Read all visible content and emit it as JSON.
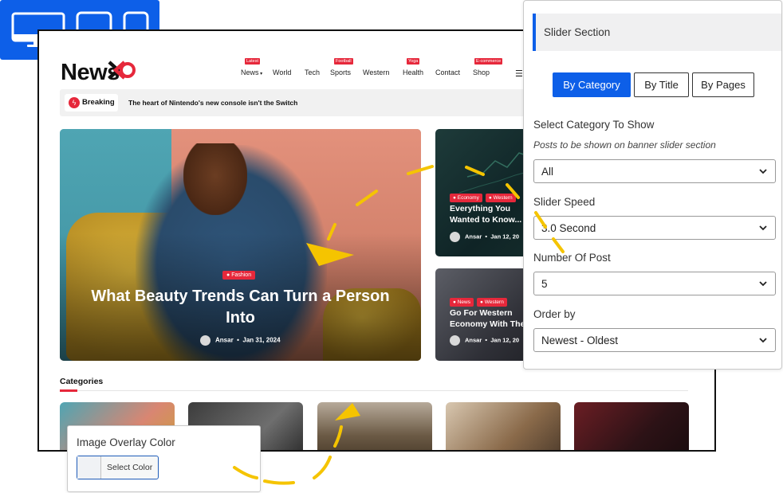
{
  "device_switcher": {
    "accent": "#0d5fe8",
    "icons": [
      "desktop-icon",
      "tablet-icon",
      "mobile-icon"
    ]
  },
  "site": {
    "logo_text": "News",
    "logo_suffix": "X",
    "nav": [
      {
        "label": "News",
        "badge": "Latest",
        "has_caret": true
      },
      {
        "label": "World",
        "badge": ""
      },
      {
        "label": "Tech",
        "badge": ""
      },
      {
        "label": "Sports",
        "badge": "Football"
      },
      {
        "label": "Western",
        "badge": ""
      },
      {
        "label": "Health",
        "badge": "Yoga"
      },
      {
        "label": "Contact",
        "badge": ""
      },
      {
        "label": "Shop",
        "badge": "E-commerce"
      }
    ],
    "breaking_label": "Breaking",
    "breaking_text": "The heart of Nintendo's new console isn't the Switch",
    "hero": {
      "badge": "Fashion",
      "title": "What Beauty Trends Can Turn a Person Into",
      "author": "Ansar",
      "date": "Jan 31, 2024"
    },
    "cards": [
      {
        "badges": [
          "Economy",
          "Western"
        ],
        "title_line1": "Everything You",
        "title_line2": "Wanted to Know...",
        "author": "Ansar",
        "date": "Jan 12, 20"
      },
      {
        "badges": [
          "News",
          "Western"
        ],
        "title_line1": "Go For Western",
        "title_line2": "Economy With The",
        "author": "Ansar",
        "date": "Jan 12, 20"
      }
    ],
    "categories_title": "Categories",
    "brand_red": "#e6283b"
  },
  "panel": {
    "title": "Slider Section",
    "tabs": [
      "By Category",
      "By Title",
      "By Pages"
    ],
    "active_tab": "By Category",
    "category_label": "Select Category To Show",
    "category_desc": "Posts to be shown on banner slider section",
    "category_value": "All",
    "speed_label": "Slider Speed",
    "speed_value": "3.0 Second",
    "count_label": "Number Of Post",
    "count_value": "5",
    "order_label": "Order by",
    "order_value": "Newest - Oldest"
  },
  "overlay_color": {
    "label": "Image Overlay Color",
    "button_label": "Select Color"
  }
}
